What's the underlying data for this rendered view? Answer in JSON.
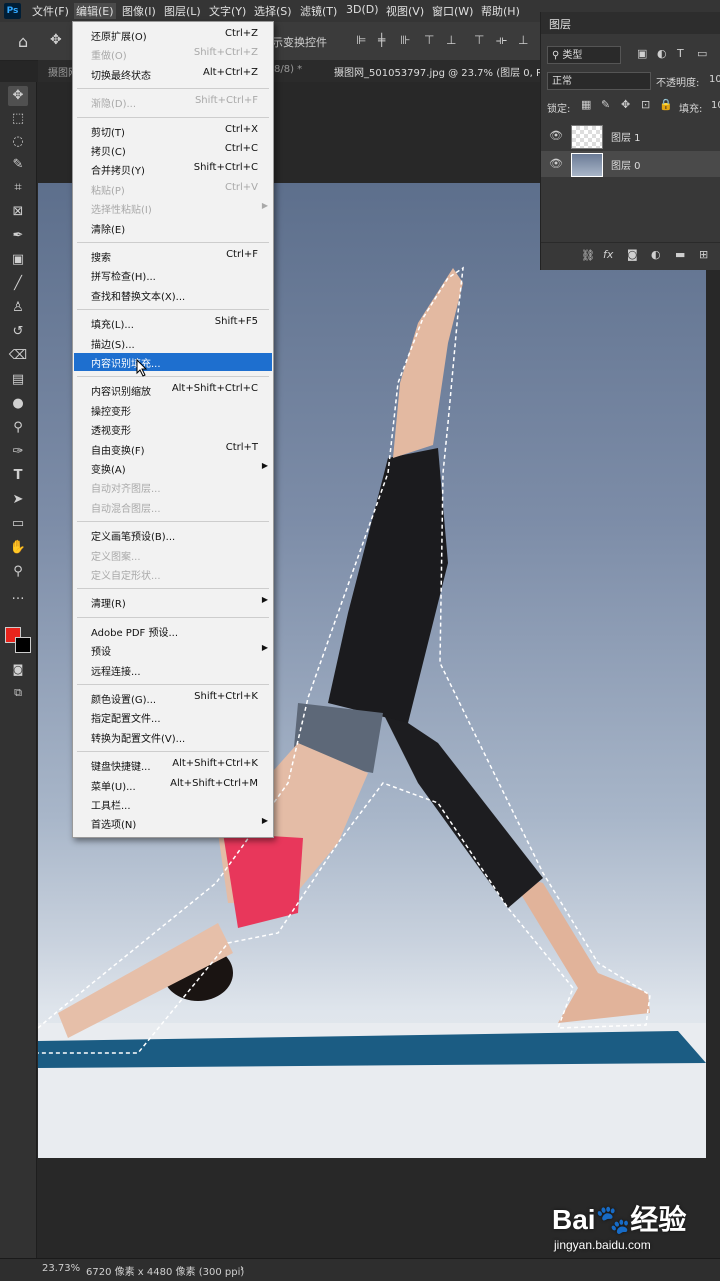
{
  "app": {
    "logo": "Ps"
  },
  "menubar": {
    "items": [
      "文件(F)",
      "编辑(E)",
      "图像(I)",
      "图层(L)",
      "文字(Y)",
      "选择(S)",
      "滤镜(T)",
      "3D(D)",
      "视图(V)",
      "窗口(W)",
      "帮助(H)"
    ],
    "active_index": 1
  },
  "options_bar": {
    "show_transform_controls": "示变换控件"
  },
  "tabs": [
    {
      "label": "摄图网...",
      "active": false
    },
    {
      "label": "8/8) *",
      "active": false
    },
    {
      "label": "摄图网_501053797.jpg @ 23.7% (图层 0, R",
      "active": true
    }
  ],
  "edit_menu": {
    "items": [
      {
        "label": "还原扩展(O)",
        "shortcut": "Ctrl+Z",
        "disabled": false
      },
      {
        "label": "重做(O)",
        "shortcut": "Shift+Ctrl+Z",
        "disabled": true
      },
      {
        "label": "切换最终状态",
        "shortcut": "Alt+Ctrl+Z",
        "disabled": false
      },
      {
        "sep": true
      },
      {
        "label": "渐隐(D)...",
        "shortcut": "Shift+Ctrl+F",
        "disabled": true
      },
      {
        "sep": true
      },
      {
        "label": "剪切(T)",
        "shortcut": "Ctrl+X",
        "disabled": false
      },
      {
        "label": "拷贝(C)",
        "shortcut": "Ctrl+C",
        "disabled": false
      },
      {
        "label": "合并拷贝(Y)",
        "shortcut": "Shift+Ctrl+C",
        "disabled": false
      },
      {
        "label": "粘贴(P)",
        "shortcut": "Ctrl+V",
        "disabled": true
      },
      {
        "label": "选择性粘贴(I)",
        "shortcut": "",
        "disabled": true,
        "submenu": true
      },
      {
        "label": "清除(E)",
        "shortcut": "",
        "disabled": false
      },
      {
        "sep": true
      },
      {
        "label": "搜索",
        "shortcut": "Ctrl+F",
        "disabled": false
      },
      {
        "label": "拼写检查(H)...",
        "shortcut": "",
        "disabled": false
      },
      {
        "label": "查找和替换文本(X)...",
        "shortcut": "",
        "disabled": false
      },
      {
        "sep": true
      },
      {
        "label": "填充(L)...",
        "shortcut": "Shift+F5",
        "disabled": false
      },
      {
        "label": "描边(S)...",
        "shortcut": "",
        "disabled": false
      },
      {
        "label": "内容识别填充...",
        "shortcut": "",
        "disabled": false,
        "highlighted": true
      },
      {
        "sep": true
      },
      {
        "label": "内容识别缩放",
        "shortcut": "Alt+Shift+Ctrl+C",
        "disabled": false
      },
      {
        "label": "操控变形",
        "shortcut": "",
        "disabled": false
      },
      {
        "label": "透视变形",
        "shortcut": "",
        "disabled": false
      },
      {
        "label": "自由变换(F)",
        "shortcut": "Ctrl+T",
        "disabled": false
      },
      {
        "label": "变换(A)",
        "shortcut": "",
        "disabled": false,
        "submenu": true
      },
      {
        "label": "自动对齐图层...",
        "shortcut": "",
        "disabled": true
      },
      {
        "label": "自动混合图层...",
        "shortcut": "",
        "disabled": true
      },
      {
        "sep": true
      },
      {
        "label": "定义画笔预设(B)...",
        "shortcut": "",
        "disabled": false
      },
      {
        "label": "定义图案...",
        "shortcut": "",
        "disabled": true
      },
      {
        "label": "定义自定形状...",
        "shortcut": "",
        "disabled": true
      },
      {
        "sep": true
      },
      {
        "label": "清理(R)",
        "shortcut": "",
        "disabled": false,
        "submenu": true
      },
      {
        "sep": true
      },
      {
        "label": "Adobe PDF 预设...",
        "shortcut": "",
        "disabled": false
      },
      {
        "label": "预设",
        "shortcut": "",
        "disabled": false,
        "submenu": true
      },
      {
        "label": "远程连接...",
        "shortcut": "",
        "disabled": false
      },
      {
        "sep": true
      },
      {
        "label": "颜色设置(G)...",
        "shortcut": "Shift+Ctrl+K",
        "disabled": false
      },
      {
        "label": "指定配置文件...",
        "shortcut": "",
        "disabled": false
      },
      {
        "label": "转换为配置文件(V)...",
        "shortcut": "",
        "disabled": false
      },
      {
        "sep": true
      },
      {
        "label": "键盘快捷键...",
        "shortcut": "Alt+Shift+Ctrl+K",
        "disabled": false
      },
      {
        "label": "菜单(U)...",
        "shortcut": "Alt+Shift+Ctrl+M",
        "disabled": false
      },
      {
        "label": "工具栏...",
        "shortcut": "",
        "disabled": false
      },
      {
        "label": "首选项(N)",
        "shortcut": "",
        "disabled": false,
        "submenu": true
      }
    ]
  },
  "layers_panel": {
    "title": "图层",
    "filter_kind": "类型",
    "blend_mode": "正常",
    "opacity_label": "不透明度:",
    "opacity_value": "10",
    "lock_label": "锁定:",
    "fill_label": "填充:",
    "fill_value": "10",
    "layers": [
      {
        "name": "图层 1",
        "selected": false
      },
      {
        "name": "图层 0",
        "selected": true
      }
    ],
    "footer_fx": "fx"
  },
  "status_bar": {
    "zoom": "23.73%",
    "doc_info": "6720 像素 x 4480 像素 (300 ppi)"
  },
  "watermark": {
    "logo_text": "Bai🐾经验",
    "url": "jingyan.baidu.com"
  },
  "colors": {
    "foreground": "#e8241c",
    "background": "#000000",
    "highlight": "#1e6fcf"
  }
}
